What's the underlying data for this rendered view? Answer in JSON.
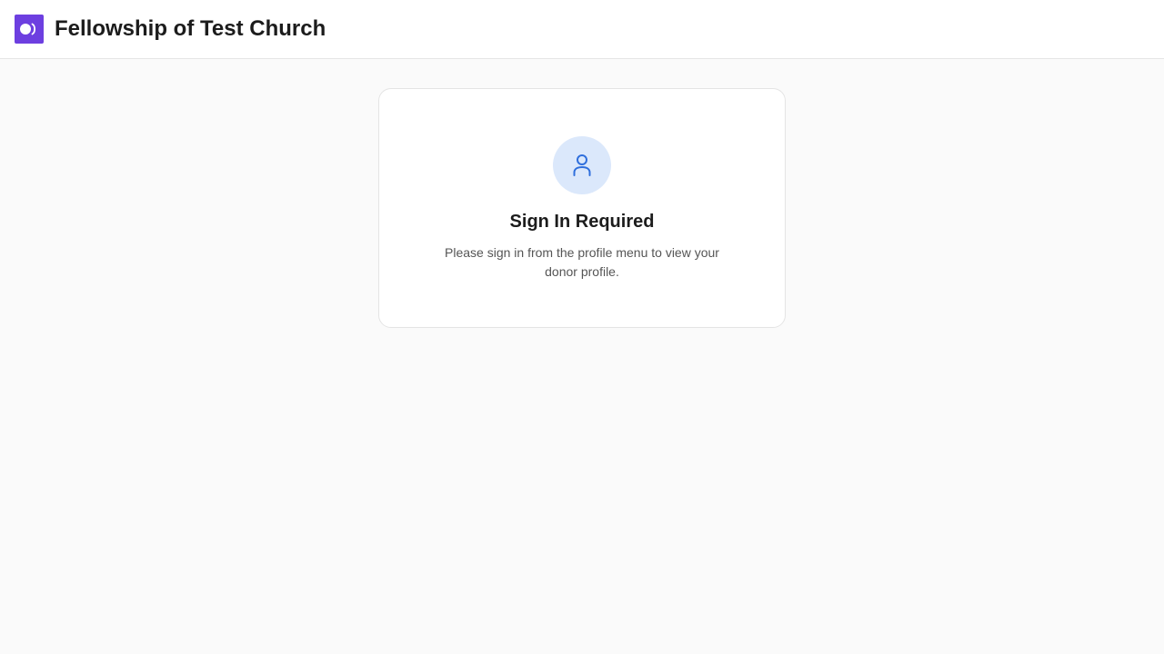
{
  "header": {
    "title": "Fellowship of Test Church",
    "logo_icon": "church-logo-icon",
    "logo_color": "#6d3fe0"
  },
  "signin_card": {
    "icon": "user-icon",
    "icon_color": "#2f6fdc",
    "icon_background": "#dbe8fb",
    "title": "Sign In Required",
    "message": "Please sign in from the profile menu to view your donor profile."
  },
  "colors": {
    "page_background": "#fafafa",
    "header_background": "#ffffff",
    "card_border": "#e4e4e4"
  }
}
